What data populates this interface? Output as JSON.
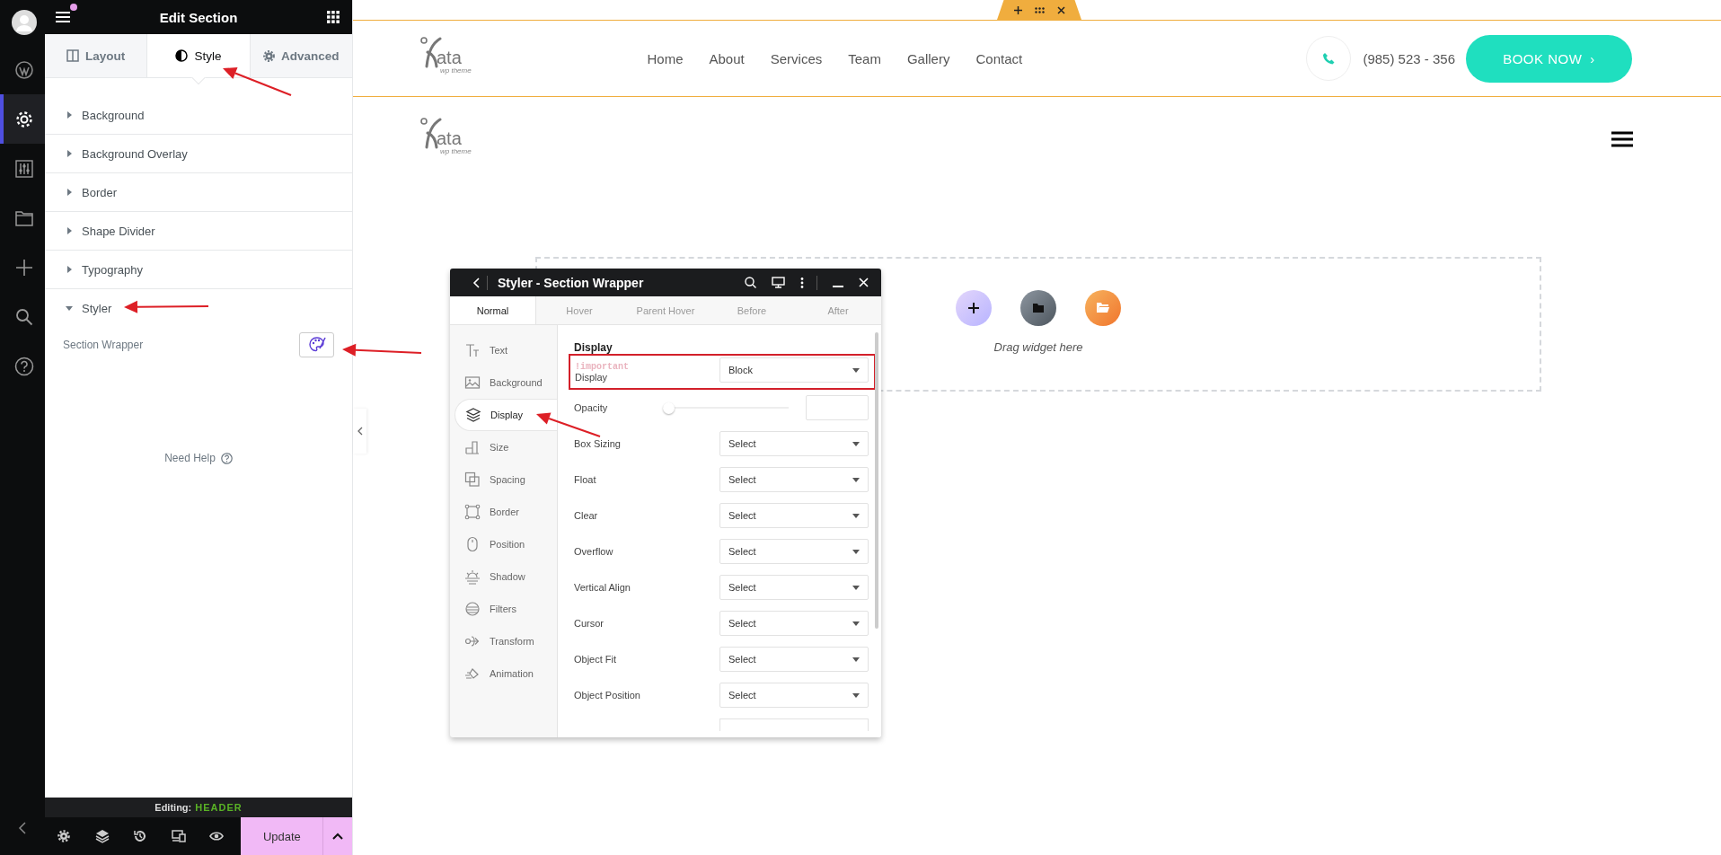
{
  "rail": [
    {
      "kind": "avatar",
      "selected": false
    },
    {
      "kind": "wordpress",
      "selected": false
    },
    {
      "kind": "settings",
      "selected": true
    },
    {
      "kind": "sliders",
      "selected": false
    },
    {
      "kind": "folder",
      "selected": false
    },
    {
      "kind": "plus",
      "selected": false
    },
    {
      "kind": "search",
      "selected": false
    },
    {
      "kind": "help",
      "selected": false
    }
  ],
  "panel": {
    "title": "Edit Section",
    "tabs": [
      {
        "label": "Layout",
        "kind": "layout",
        "selected": false
      },
      {
        "label": "Style",
        "kind": "style",
        "selected": true
      },
      {
        "label": "Advanced",
        "kind": "advanced",
        "selected": false
      }
    ],
    "sections": [
      {
        "label": "Background",
        "expanded": false
      },
      {
        "label": "Background Overlay",
        "expanded": false
      },
      {
        "label": "Border",
        "expanded": false
      },
      {
        "label": "Shape Divider",
        "expanded": false
      },
      {
        "label": "Typography",
        "expanded": false
      },
      {
        "label": "Styler",
        "expanded": true
      }
    ],
    "styler_control": {
      "label": "Section Wrapper"
    },
    "help": "Need Help",
    "editing_label": "Editing:",
    "editing_value": "HEADER",
    "update": "Update"
  },
  "site_header": {
    "logo": {
      "text": "ata",
      "tagline": "wp theme"
    },
    "nav": [
      "Home",
      "About",
      "Services",
      "Team",
      "Gallery",
      "Contact"
    ],
    "phone": "(985) 523 - 356",
    "cta": "BOOK NOW",
    "cta_arrow": "›"
  },
  "mobile_header": {
    "logo": {
      "text": "ata",
      "tagline": "wp theme"
    }
  },
  "drop_zone": {
    "hint": "Drag widget here"
  },
  "styler": {
    "title": "Styler - Section Wrapper",
    "state_tabs": [
      {
        "label": "Normal",
        "selected": true
      },
      {
        "label": "Hover",
        "selected": false
      },
      {
        "label": "Parent Hover",
        "selected": false
      },
      {
        "label": "Before",
        "selected": false
      },
      {
        "label": "After",
        "selected": false
      }
    ],
    "categories": [
      {
        "label": "Text",
        "kind": "text",
        "selected": false
      },
      {
        "label": "Background",
        "kind": "background",
        "selected": false
      },
      {
        "label": "Display",
        "kind": "display",
        "selected": true
      },
      {
        "label": "Size",
        "kind": "size",
        "selected": false
      },
      {
        "label": "Spacing",
        "kind": "spacing",
        "selected": false
      },
      {
        "label": "Border",
        "kind": "border",
        "selected": false
      },
      {
        "label": "Position",
        "kind": "position",
        "selected": false
      },
      {
        "label": "Shadow",
        "kind": "shadow",
        "selected": false
      },
      {
        "label": "Filters",
        "kind": "filters",
        "selected": false
      },
      {
        "label": "Transform",
        "kind": "transform",
        "selected": false
      },
      {
        "label": "Animation",
        "kind": "animation",
        "selected": false
      }
    ],
    "section_title": "Display",
    "important": "!important",
    "display": {
      "label": "Display",
      "value": "Block"
    },
    "opacity": {
      "label": "Opacity",
      "level": 0
    },
    "properties": [
      {
        "label": "Box Sizing",
        "value": "Select"
      },
      {
        "label": "Float",
        "value": "Select"
      },
      {
        "label": "Clear",
        "value": "Select"
      },
      {
        "label": "Overflow",
        "value": "Select"
      },
      {
        "label": "Vertical Align",
        "value": "Select"
      },
      {
        "label": "Cursor",
        "value": "Select"
      },
      {
        "label": "Object Fit",
        "value": "Select"
      },
      {
        "label": "Object Position",
        "value": "Select"
      }
    ]
  }
}
